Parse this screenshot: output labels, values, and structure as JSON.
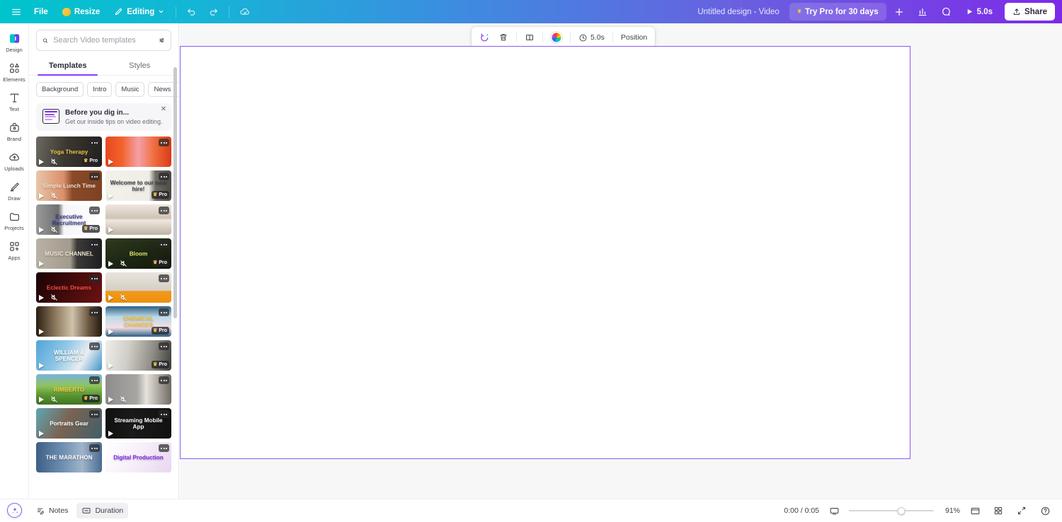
{
  "header": {
    "menu_icon": "hamburger-menu-icon",
    "file_label": "File",
    "resize_label": "Resize",
    "editing_label": "Editing",
    "undo_icon": "undo-icon",
    "redo_icon": "redo-icon",
    "cloud_icon": "cloud-save-icon",
    "doc_title": "Untitled design - Video",
    "try_pro_label": "Try Pro for 30 days",
    "add_icon": "plus-icon",
    "insights_icon": "insights-chart-icon",
    "comment_icon": "comment-icon",
    "play_label": "5.0s",
    "share_label": "Share"
  },
  "rail": {
    "items": [
      {
        "label": "Design",
        "icon": "design-icon",
        "active": true
      },
      {
        "label": "Elements",
        "icon": "elements-icon",
        "active": false
      },
      {
        "label": "Text",
        "icon": "text-icon",
        "active": false
      },
      {
        "label": "Brand",
        "icon": "brand-icon",
        "active": false
      },
      {
        "label": "Uploads",
        "icon": "uploads-icon",
        "active": false
      },
      {
        "label": "Draw",
        "icon": "draw-icon",
        "active": false
      },
      {
        "label": "Projects",
        "icon": "projects-icon",
        "active": false
      },
      {
        "label": "Apps",
        "icon": "apps-icon",
        "active": false
      }
    ]
  },
  "panel": {
    "search": {
      "placeholder": "Search Video templates",
      "value": "",
      "search_icon": "search-icon",
      "filter_icon": "filter-sliders-icon"
    },
    "tabs": [
      {
        "label": "Templates",
        "active": true
      },
      {
        "label": "Styles",
        "active": false
      }
    ],
    "chips": [
      "Background",
      "Intro",
      "Music",
      "News"
    ],
    "chips_more_icon": "chevron-right-icon",
    "promo": {
      "title": "Before you dig in...",
      "subtitle": "Get our inside tips on video editing.",
      "close_icon": "close-icon",
      "thumb_icon": "video-template-icon"
    },
    "pro_label": "Pro",
    "templates": [
      {
        "title": "Yoga Therapy",
        "pro": true,
        "mute": true,
        "play": true,
        "art": "dark-gym",
        "text_color": "#e8c84a"
      },
      {
        "title": "",
        "pro": false,
        "mute": false,
        "play": true,
        "art": "orange-retro",
        "text_color": "#ffffff"
      },
      {
        "title": "Simple Lunch Time",
        "pro": false,
        "mute": true,
        "play": true,
        "art": "brown-food",
        "text_color": "#f3e7d7"
      },
      {
        "title": "Welcome to our new hire!",
        "pro": true,
        "mute": false,
        "play": true,
        "art": "cream-doc",
        "text_color": "#3d3f48"
      },
      {
        "title": "Executive Recruitment",
        "pro": true,
        "mute": true,
        "play": true,
        "art": "grey-portrait",
        "text_color": "#3b3d8f"
      },
      {
        "title": "",
        "pro": false,
        "mute": false,
        "play": true,
        "art": "collage-grid",
        "text_color": "#c0392b"
      },
      {
        "title": "MUSIC CHANNEL",
        "pro": false,
        "mute": false,
        "play": true,
        "art": "vinyl-grey",
        "text_color": "#f1e6d2"
      },
      {
        "title": "Bloom",
        "pro": true,
        "mute": true,
        "play": true,
        "art": "dark-olive",
        "text_color": "#e3e86a"
      },
      {
        "title": "Eclectic Dreams",
        "pro": false,
        "mute": true,
        "play": true,
        "art": "red-neon",
        "text_color": "#ff4d4d"
      },
      {
        "title": "",
        "pro": false,
        "mute": true,
        "play": true,
        "art": "orange-kitchen",
        "text_color": "#ffffff"
      },
      {
        "title": "",
        "pro": false,
        "mute": false,
        "play": true,
        "art": "sepia-book",
        "text_color": "#ffffff"
      },
      {
        "title": "CHEMICAL CHANGES",
        "pro": true,
        "mute": false,
        "play": true,
        "art": "blue-chem",
        "text_color": "#f5c542"
      },
      {
        "title": "WILLIAM & SPENCER",
        "pro": false,
        "mute": false,
        "play": true,
        "art": "blue-wedding",
        "text_color": "#ffffff"
      },
      {
        "title": "",
        "pro": true,
        "mute": false,
        "play": true,
        "art": "office-meeting",
        "text_color": "#3d3f48"
      },
      {
        "title": "RIMBERTO",
        "pro": true,
        "mute": true,
        "play": true,
        "art": "green-field",
        "text_color": "#f5d142"
      },
      {
        "title": "",
        "pro": false,
        "mute": true,
        "play": true,
        "art": "grey-interior",
        "text_color": "#f5c542"
      },
      {
        "title": "Portraits Gear",
        "pro": false,
        "mute": false,
        "play": true,
        "art": "teal-face",
        "text_color": "#ffffff"
      },
      {
        "title": "Streaming Mobile App",
        "pro": false,
        "mute": false,
        "play": true,
        "art": "black-app",
        "text_color": "#ffffff"
      },
      {
        "title": "THE MARATHON",
        "pro": false,
        "mute": false,
        "play": false,
        "art": "blue-people",
        "text_color": "#ffffff"
      },
      {
        "title": "Digital Production",
        "pro": false,
        "mute": false,
        "play": false,
        "art": "white-digital",
        "text_color": "#7d2ae8"
      }
    ]
  },
  "toolbar": {
    "animate_icon": "magic-animate-icon",
    "delete_icon": "trash-icon",
    "duplicate_icon": "duplicate-page-icon",
    "color_icon": "color-wheel-icon",
    "duration_icon": "clock-icon",
    "duration_label": "5.0s",
    "position_label": "Position"
  },
  "bottom": {
    "assistant_icon": "magic-assistant-icon",
    "notes_label": "Notes",
    "notes_icon": "notes-icon",
    "duration_label": "Duration",
    "duration_icon": "duration-icon",
    "timecode": "0:00 / 0:05",
    "display_icon": "display-icon",
    "zoom_level": "91%",
    "pages_icon": "page-view-icon",
    "grid_icon": "grid-view-icon",
    "fullscreen_icon": "fullscreen-icon",
    "help_icon": "help-icon"
  },
  "colors": {
    "brand_purple": "#7d2ae8",
    "brand_teal": "#00c4cc",
    "selection": "#8b5cf6",
    "accent_yellow": "#f5c542"
  }
}
